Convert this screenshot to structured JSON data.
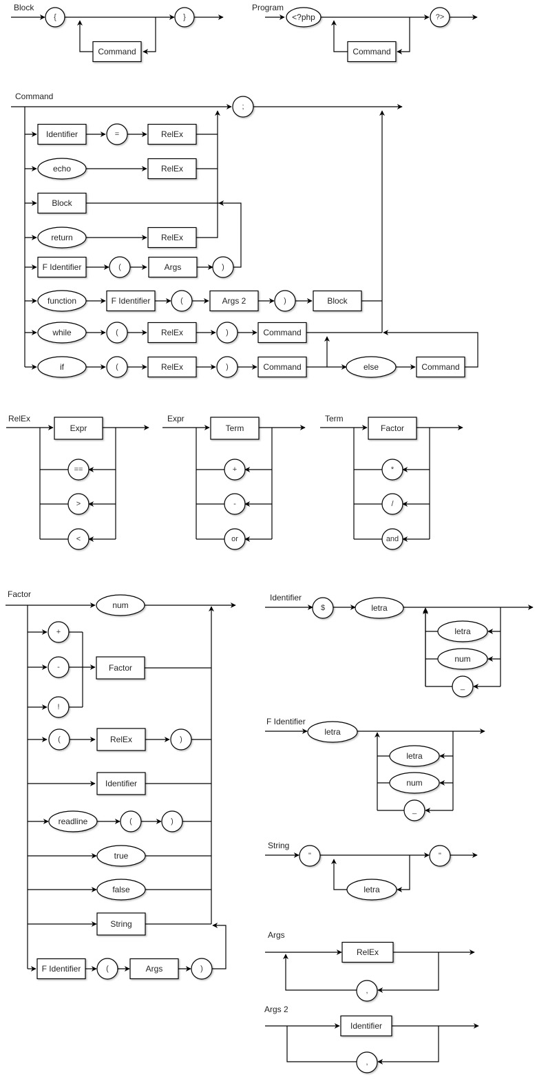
{
  "diagram": {
    "type": "syntax-diagrams",
    "language": "PHP subset",
    "rules": [
      {
        "id": "block",
        "title": "Block",
        "tokens": {
          "open": "{",
          "close": "}",
          "command": "Command"
        }
      },
      {
        "id": "program",
        "title": "Program",
        "tokens": {
          "open": "<?php",
          "close": "?>",
          "command": "Command"
        }
      },
      {
        "id": "command",
        "title": "Command",
        "terminator": ";",
        "branches": {
          "assign": {
            "identifier": "Identifier",
            "eq": "=",
            "relex": "RelEx"
          },
          "echo": {
            "kw": "echo",
            "relex": "RelEx"
          },
          "block": {
            "block": "Block"
          },
          "return": {
            "kw": "return",
            "relex": "RelEx"
          },
          "call": {
            "fid": "F Identifier",
            "lp": "(",
            "args": "Args",
            "rp": ")"
          },
          "function": {
            "kw": "function",
            "fid": "F Identifier",
            "lp": "(",
            "args": "Args 2",
            "rp": ")",
            "block": "Block"
          },
          "while": {
            "kw": "while",
            "lp": "(",
            "relex": "RelEx",
            "rp": ")",
            "command": "Command"
          },
          "if": {
            "kw": "if",
            "lp": "(",
            "relex": "RelEx",
            "rp": ")",
            "command": "Command",
            "else": "else",
            "else_command": "Command"
          }
        }
      },
      {
        "id": "relex",
        "title": "RelEx",
        "main": "Expr",
        "ops": [
          "==",
          ">",
          "<"
        ]
      },
      {
        "id": "expr",
        "title": "Expr",
        "main": "Term",
        "ops": [
          "+",
          "-",
          "or"
        ]
      },
      {
        "id": "term",
        "title": "Term",
        "main": "Factor",
        "ops": [
          "*",
          "/",
          "and"
        ]
      },
      {
        "id": "factor",
        "title": "Factor",
        "branches": {
          "num": "num",
          "unary_ops": [
            "+",
            "-",
            "!"
          ],
          "unary_target": "Factor",
          "paren": {
            "lp": "(",
            "relex": "RelEx",
            "rp": ")"
          },
          "identifier": "Identifier",
          "readline": {
            "kw": "readline",
            "lp": "(",
            "rp": ")"
          },
          "true": "true",
          "false": "false",
          "string": "String",
          "call": {
            "fid": "F Identifier",
            "lp": "(",
            "args": "Args",
            "rp": ")"
          }
        }
      },
      {
        "id": "identifier",
        "title": "Identifier",
        "dollar": "$",
        "first": "letra",
        "loop": [
          "letra",
          "num",
          "_"
        ]
      },
      {
        "id": "fidentifier",
        "title": "F Identifier",
        "first": "letra",
        "loop": [
          "letra",
          "num",
          "_"
        ]
      },
      {
        "id": "string",
        "title": "String",
        "open": "\"",
        "close": "\"",
        "loop": "letra"
      },
      {
        "id": "args",
        "title": "Args",
        "main": "RelEx",
        "sep": ","
      },
      {
        "id": "args2",
        "title": "Args 2",
        "main": "Identifier",
        "sep": ","
      }
    ]
  }
}
